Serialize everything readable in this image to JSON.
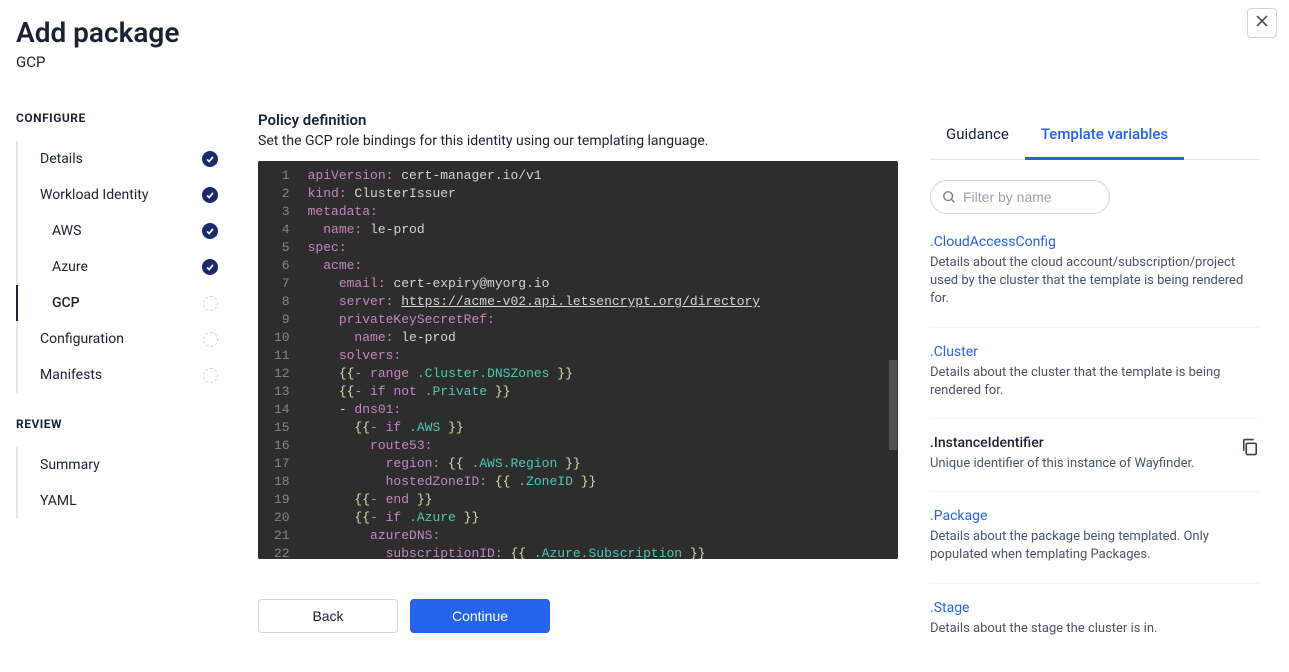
{
  "header": {
    "title": "Add package",
    "subtitle": "GCP"
  },
  "sidebar": {
    "configure_label": "CONFIGURE",
    "review_label": "REVIEW",
    "configure_items": [
      {
        "label": "Details",
        "status": "checked",
        "sub": false,
        "active": false
      },
      {
        "label": "Workload Identity",
        "status": "checked",
        "sub": false,
        "active": false
      },
      {
        "label": "AWS",
        "status": "checked",
        "sub": true,
        "active": false
      },
      {
        "label": "Azure",
        "status": "checked",
        "sub": true,
        "active": false
      },
      {
        "label": "GCP",
        "status": "pending",
        "sub": true,
        "active": true
      },
      {
        "label": "Configuration",
        "status": "pending",
        "sub": false,
        "active": false
      },
      {
        "label": "Manifests",
        "status": "pending",
        "sub": false,
        "active": false
      }
    ],
    "review_items": [
      {
        "label": "Summary"
      },
      {
        "label": "YAML"
      }
    ]
  },
  "content": {
    "section_title": "Policy definition",
    "section_desc": "Set the GCP role bindings for this identity using our templating language.",
    "code_lines": [
      [
        [
          "key",
          "apiVersion:"
        ],
        [
          "str",
          " cert-manager.io/v1"
        ]
      ],
      [
        [
          "key",
          "kind:"
        ],
        [
          "str",
          " ClusterIssuer"
        ]
      ],
      [
        [
          "key",
          "metadata:"
        ]
      ],
      [
        [
          "str",
          "  "
        ],
        [
          "key",
          "name:"
        ],
        [
          "str",
          " le-prod"
        ]
      ],
      [
        [
          "key",
          "spec:"
        ]
      ],
      [
        [
          "str",
          "  "
        ],
        [
          "key",
          "acme:"
        ]
      ],
      [
        [
          "str",
          "    "
        ],
        [
          "key",
          "email:"
        ],
        [
          "str",
          " cert-expiry@myorg.io"
        ]
      ],
      [
        [
          "str",
          "    "
        ],
        [
          "key",
          "server:"
        ],
        [
          "str",
          " "
        ],
        [
          "link",
          "https://acme-v02.api.letsencrypt.org/directory"
        ]
      ],
      [
        [
          "str",
          "    "
        ],
        [
          "key",
          "privateKeySecretRef:"
        ]
      ],
      [
        [
          "str",
          "      "
        ],
        [
          "key",
          "name:"
        ],
        [
          "str",
          " le-prod"
        ]
      ],
      [
        [
          "str",
          "    "
        ],
        [
          "key",
          "solvers:"
        ]
      ],
      [
        [
          "str",
          "    "
        ],
        [
          "dbl",
          "{{"
        ],
        [
          "kw",
          "- range "
        ],
        [
          "var",
          ".Cluster.DNSZones "
        ],
        [
          "dbl",
          "}}"
        ]
      ],
      [
        [
          "str",
          "    "
        ],
        [
          "dbl",
          "{{"
        ],
        [
          "kw",
          "- if not "
        ],
        [
          "var",
          ".Private "
        ],
        [
          "dbl",
          "}}"
        ]
      ],
      [
        [
          "str",
          "    - "
        ],
        [
          "key",
          "dns01:"
        ]
      ],
      [
        [
          "str",
          "      "
        ],
        [
          "dbl",
          "{{"
        ],
        [
          "kw",
          "- if "
        ],
        [
          "var",
          ".AWS "
        ],
        [
          "dbl",
          "}}"
        ]
      ],
      [
        [
          "str",
          "        "
        ],
        [
          "key",
          "route53:"
        ]
      ],
      [
        [
          "str",
          "          "
        ],
        [
          "key",
          "region:"
        ],
        [
          "str",
          " "
        ],
        [
          "dbl",
          "{{ "
        ],
        [
          "var",
          ".AWS.Region "
        ],
        [
          "dbl",
          "}}"
        ]
      ],
      [
        [
          "str",
          "          "
        ],
        [
          "key",
          "hostedZoneID:"
        ],
        [
          "str",
          " "
        ],
        [
          "dbl",
          "{{ "
        ],
        [
          "var",
          ".ZoneID "
        ],
        [
          "dbl",
          "}}"
        ]
      ],
      [
        [
          "str",
          "      "
        ],
        [
          "dbl",
          "{{"
        ],
        [
          "kw",
          "- end "
        ],
        [
          "dbl",
          "}}"
        ]
      ],
      [
        [
          "str",
          "      "
        ],
        [
          "dbl",
          "{{"
        ],
        [
          "kw",
          "- if "
        ],
        [
          "var",
          ".Azure "
        ],
        [
          "dbl",
          "}}"
        ]
      ],
      [
        [
          "str",
          "        "
        ],
        [
          "key",
          "azureDNS:"
        ]
      ],
      [
        [
          "str",
          "          "
        ],
        [
          "key",
          "subscriptionID:"
        ],
        [
          "str",
          " "
        ],
        [
          "dbl",
          "{{ "
        ],
        [
          "var",
          ".Azure.Subscription "
        ],
        [
          "dbl",
          "}}"
        ]
      ]
    ],
    "back_label": "Back",
    "continue_label": "Continue"
  },
  "rightpanel": {
    "tabs": [
      {
        "label": "Guidance",
        "active": false
      },
      {
        "label": "Template variables",
        "active": true
      }
    ],
    "filter_placeholder": "Filter by name",
    "variables": [
      {
        "name": ".CloudAccessConfig",
        "desc": "Details about the cloud account/subscription/project used by the cluster that the template is being rendered for.",
        "link": true,
        "copy": false
      },
      {
        "name": ".Cluster",
        "desc": "Details about the cluster that the template is being rendered for.",
        "link": true,
        "copy": false
      },
      {
        "name": ".InstanceIdentifier",
        "desc": "Unique identifier of this instance of Wayfinder.",
        "link": false,
        "copy": true
      },
      {
        "name": ".Package",
        "desc": "Details about the package being templated. Only populated when templating Packages.",
        "link": true,
        "copy": false
      },
      {
        "name": ".Stage",
        "desc": "Details about the stage the cluster is in.",
        "link": true,
        "copy": false
      }
    ]
  }
}
